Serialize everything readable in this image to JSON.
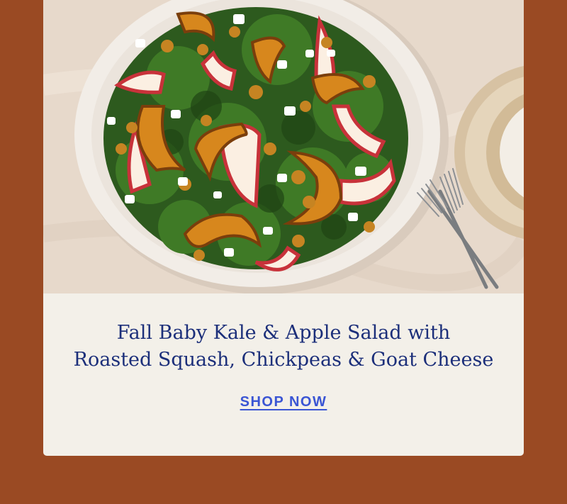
{
  "promo": {
    "image_alt": "Bowl of kale salad with apple slices, roasted squash, chickpeas and goat cheese",
    "title_line1": "Fall Baby Kale & Apple Salad with",
    "title_line2": "Roasted Squash, Chickpeas & Goat Cheese",
    "cta_label": "SHOP NOW"
  },
  "colors": {
    "page_bg": "#9a4a23",
    "card_bg": "#f3f0e9",
    "title_text": "#1c2f7a",
    "cta_text": "#3a55d4"
  }
}
